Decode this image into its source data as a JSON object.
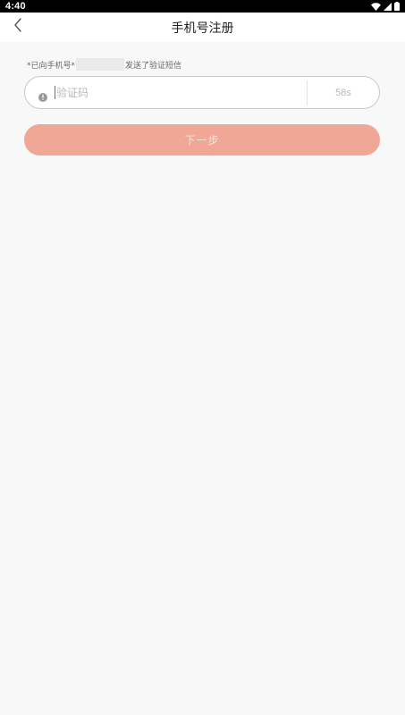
{
  "status_bar": {
    "time": "4:40",
    "icons": [
      "wifi-icon",
      "signal-icon",
      "battery-icon"
    ]
  },
  "app_bar": {
    "title": "手机号注册",
    "back_icon": "chevron-left-icon"
  },
  "hint": {
    "prefix": "*已向手机号*",
    "suffix": "发送了验证短信"
  },
  "code_field": {
    "placeholder": "验证码",
    "value": "",
    "icon": "info-icon",
    "countdown": "58s"
  },
  "next_button": {
    "label": "下一步"
  },
  "colors": {
    "button": "#f1a795",
    "background": "#f8f8f8",
    "cursor": "#3d6fe6"
  }
}
